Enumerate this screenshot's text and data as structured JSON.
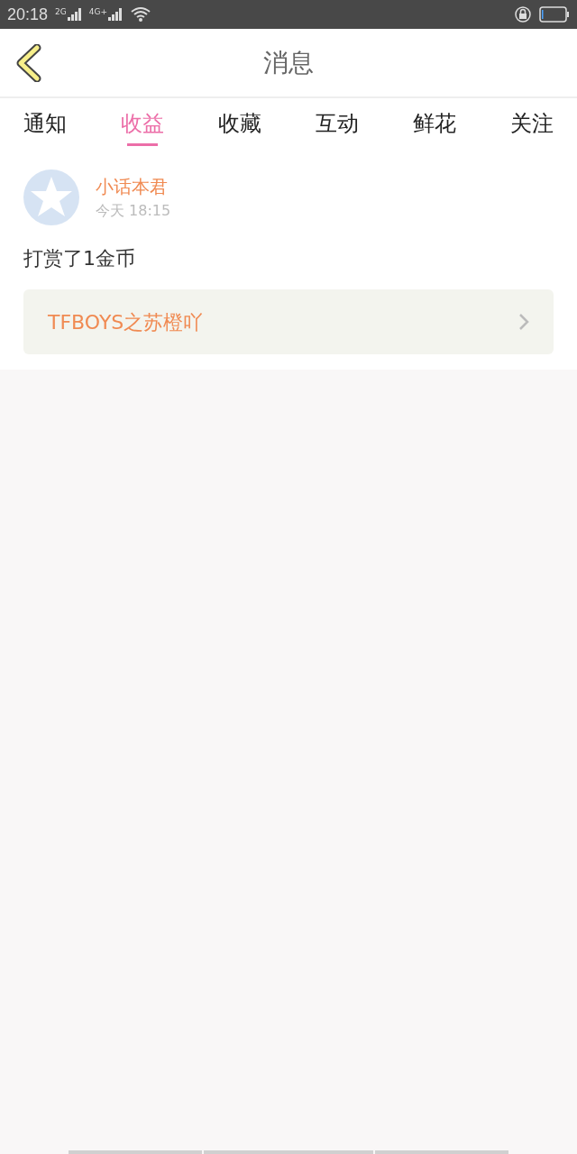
{
  "status_bar": {
    "time": "20:18",
    "signal_labels": [
      "2G",
      "4G+"
    ]
  },
  "header": {
    "title": "消息"
  },
  "tabs": [
    {
      "label": "通知",
      "selected": false
    },
    {
      "label": "收益",
      "selected": true
    },
    {
      "label": "收藏",
      "selected": false
    },
    {
      "label": "互动",
      "selected": false
    },
    {
      "label": "鲜花",
      "selected": false
    },
    {
      "label": "关注",
      "selected": false
    }
  ],
  "messages": [
    {
      "user": "小话本君",
      "time": "今天 18:15",
      "text": "打赏了1金币",
      "link": "TFBOYS之苏橙吖"
    }
  ]
}
